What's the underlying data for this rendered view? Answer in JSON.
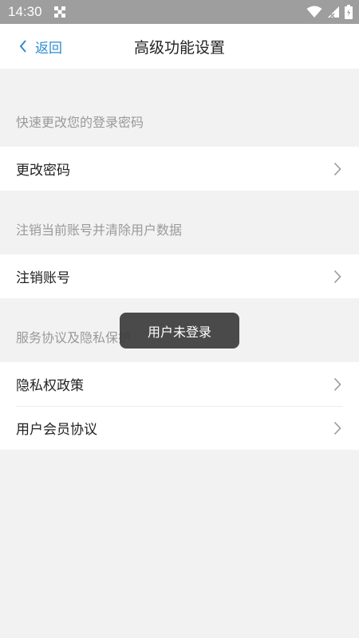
{
  "status_bar": {
    "time": "14:30",
    "icons": [
      "grid-icon",
      "wifi-icon",
      "signal-icon",
      "battery-icon"
    ]
  },
  "nav": {
    "back_label": "返回",
    "title": "高级功能设置"
  },
  "sections": [
    {
      "header": "快速更改您的登录密码",
      "items": [
        {
          "label": "更改密码"
        }
      ]
    },
    {
      "header": "注销当前账号并清除用户数据",
      "items": [
        {
          "label": "注销账号"
        }
      ]
    },
    {
      "header": "服务协议及隐私保护",
      "items": [
        {
          "label": "隐私权政策"
        },
        {
          "label": "用户会员协议"
        }
      ]
    }
  ],
  "toast": {
    "text": "用户未登录"
  },
  "colors": {
    "accent": "#2f8bd1",
    "status_bar": "#9e9e9e",
    "background": "#f2f2f2"
  }
}
